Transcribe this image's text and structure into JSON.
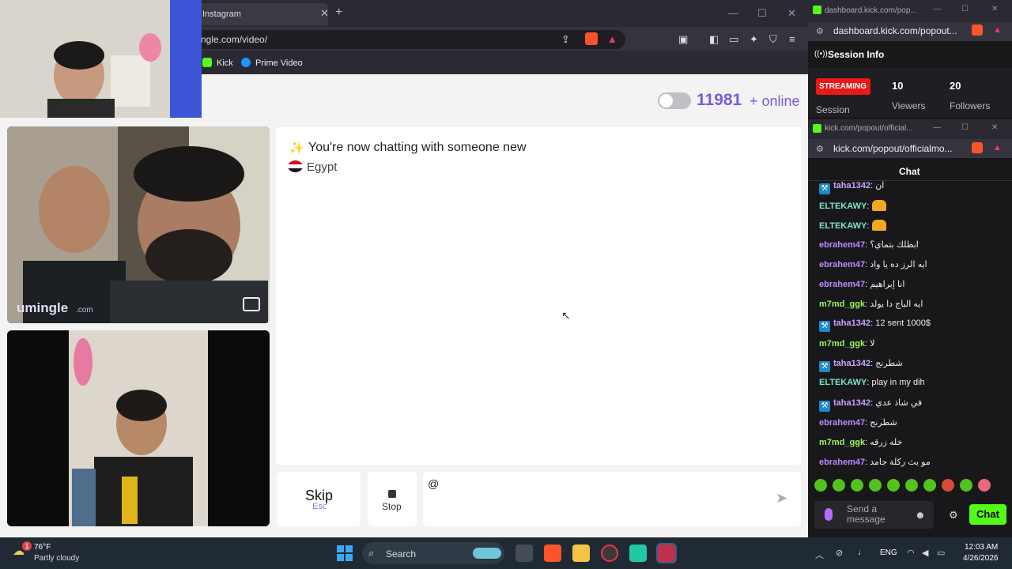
{
  "browser": {
    "tab_title": "Instagram",
    "url": "ngle.com/video/",
    "bookmarks": [
      {
        "label": "Kick",
        "color": "#53fc18"
      },
      {
        "label": "Prime Video",
        "color": "#1a98ff"
      }
    ]
  },
  "header": {
    "online_count": "11981",
    "online_label": "+ online"
  },
  "video": {
    "brand": "umingle",
    "brand_sub": ".com"
  },
  "chat": {
    "system_message": "You're now chatting with someone new",
    "country": "Egypt",
    "input_value": "@"
  },
  "controls": {
    "skip_label": "Skip",
    "skip_key": "Esc",
    "stop_label": "Stop"
  },
  "kick_dashboard": {
    "window_title": "dashboard.kick.com/pop...",
    "url": "dashboard.kick.com/popout...",
    "title": "Session Info",
    "badge": "STREAMING",
    "session_label": "Session",
    "viewers": "10",
    "viewers_label": "Viewers",
    "followers": "20",
    "followers_label": "Followers"
  },
  "kick_chat": {
    "window_title": "kick.com/popout/official...",
    "url": "kick.com/popout/officialmo...",
    "title": "Chat",
    "messages": [
      {
        "user": "taha1342",
        "color": "#c9a4ff",
        "mod": true,
        "text": ": ان"
      },
      {
        "user": "ELTEKAWY",
        "color": "#7fe3c7",
        "emote": true,
        "text": ":"
      },
      {
        "user": "ELTEKAWY",
        "color": "#7fe3c7",
        "emote": true,
        "text": ":"
      },
      {
        "user": "ebrahem47",
        "color": "#b98cff",
        "text": ": ابطلك بتماي؟"
      },
      {
        "user": "ebrahem47",
        "color": "#b98cff",
        "text": ": ايه الرز ده يا واد"
      },
      {
        "user": "ebrahem47",
        "color": "#b98cff",
        "text": ": انا إبراهيم"
      },
      {
        "user": "m7md_ggk",
        "color": "#9ef55a",
        "text": ": ايه الباج دا يولد"
      },
      {
        "user": "taha1342",
        "color": "#c9a4ff",
        "mod": true,
        "text": ": 12 sent 1000$"
      },
      {
        "user": "m7md_ggk",
        "color": "#9ef55a",
        "text": ": لا"
      },
      {
        "user": "taha1342",
        "color": "#c9a4ff",
        "mod": true,
        "text": ": شطرنج"
      },
      {
        "user": "ELTEKAWY",
        "color": "#7fe3c7",
        "text": ": play in my dih"
      },
      {
        "user": "taha1342",
        "color": "#c9a4ff",
        "mod": true,
        "text": ": في شاذ عدي"
      },
      {
        "user": "ebrahem47",
        "color": "#b98cff",
        "text": ": شطرنج"
      },
      {
        "user": "m7md_ggk",
        "color": "#9ef55a",
        "text": ": خله زرقه"
      },
      {
        "user": "ebrahem47",
        "color": "#b98cff",
        "text": ": مو بث ركلة جامد"
      }
    ],
    "send_placeholder": "Send a message",
    "chat_button": "Chat"
  },
  "taskbar": {
    "weather_temp": "76°F",
    "weather_desc": "Partly cloudy",
    "weather_badge": "1",
    "search_label": "Search",
    "language": "ENG",
    "time": "12:03 AM",
    "date": "4/26/2026"
  }
}
